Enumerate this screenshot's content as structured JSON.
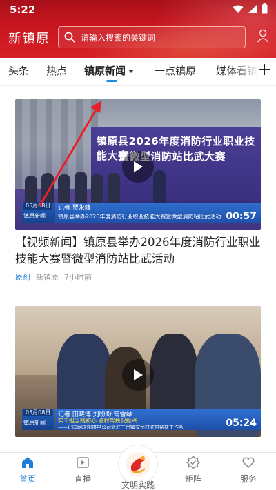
{
  "status": {
    "time": "5:22"
  },
  "header": {
    "logo": "新镇原",
    "search_placeholder": "请输入搜索的关键词"
  },
  "tabs": [
    {
      "label": "头条"
    },
    {
      "label": "热点"
    },
    {
      "label": "镇原新闻"
    },
    {
      "label": "一点镇原"
    },
    {
      "label": "媒体看镇"
    }
  ],
  "cards": [
    {
      "title": "【视频新闻】镇原县举办2026年度消防行业职业技能大赛暨微型消防站比武活动",
      "source_tag": "原创",
      "source": "新镇原",
      "time": "7小时前",
      "thumb": {
        "banner_line1": "镇原县2026年度消防行业职业技能大赛",
        "banner_line2": "暨微型消防站比武大赛",
        "date": "05月08日",
        "badge": "镇原新闻",
        "reporter": "记者  贾永峰",
        "headline": "镇原县举办2026年度消防行业职业技能大赛暨微型消防站比武活动",
        "duration": "00:57"
      }
    },
    {
      "title": "",
      "thumb": {
        "date": "05月08日",
        "badge": "镇原新闻",
        "reporter": "记者  田晓博  刘盼盼  常雪琴",
        "headline": "实干担当践初心  驻村帮扶促振兴",
        "headline2": "——记国网庆阳供电公司派驻三岔镇安岔村驻村帮扶工作队",
        "duration": "05:24"
      }
    }
  ],
  "bottom_nav": [
    {
      "label": "首页",
      "icon": "home-icon",
      "active": true
    },
    {
      "label": "直播",
      "icon": "live-icon",
      "active": false
    },
    {
      "label": "文明实践",
      "icon": "civilization-logo-icon",
      "active": false
    },
    {
      "label": "矩阵",
      "icon": "matrix-icon",
      "active": false
    },
    {
      "label": "服务",
      "icon": "service-icon",
      "active": false
    }
  ],
  "colors": {
    "header_red": "#c8161f",
    "accent_blue": "#1e8fe0",
    "arrow_red": "#e8202a"
  }
}
